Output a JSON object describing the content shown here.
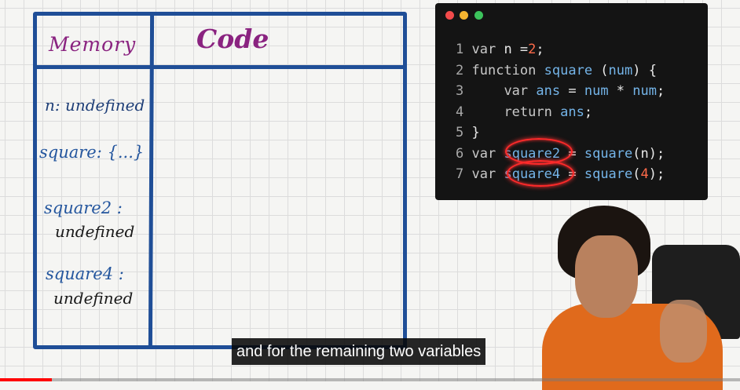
{
  "board": {
    "memory_heading": "Memory",
    "code_heading": "Code",
    "memory_entries": [
      {
        "name": "n",
        "value": ": undefined"
      },
      {
        "name": "square",
        "value": ": {...}"
      },
      {
        "name": "square2",
        "value": "undefined"
      },
      {
        "name": "square4",
        "value": "undefined"
      }
    ]
  },
  "code_window": {
    "lines": [
      {
        "no": "1",
        "text": "var n =2;"
      },
      {
        "no": "2",
        "text": "function square (num) {"
      },
      {
        "no": "3",
        "text": "    var ans = num * num;"
      },
      {
        "no": "4",
        "text": "    return ans;"
      },
      {
        "no": "5",
        "text": "}"
      },
      {
        "no": "6",
        "text": "var square2 = square(n);"
      },
      {
        "no": "7",
        "text": "var square4 = square(4);"
      }
    ],
    "colors": {
      "keyword": "#c9c9c9",
      "function": "#74b4e8",
      "number": "#ff6b4a",
      "highlight": "#ff2a2a"
    }
  },
  "caption": {
    "text": "and for the remaining two variables"
  },
  "video": {
    "progress": 0.07,
    "progress_color": "#ff0000"
  }
}
